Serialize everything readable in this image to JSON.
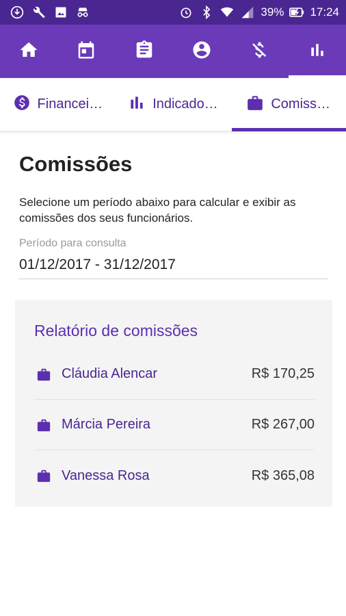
{
  "status_bar": {
    "battery": "39%",
    "time": "17:24"
  },
  "top_nav": {
    "items": [
      {
        "icon": "home-icon"
      },
      {
        "icon": "calendar-icon"
      },
      {
        "icon": "clipboard-icon"
      },
      {
        "icon": "account-icon"
      },
      {
        "icon": "money-off-icon"
      },
      {
        "icon": "bar-chart-icon",
        "active": true
      }
    ]
  },
  "sub_tabs": {
    "tabs": [
      {
        "label": "Financei…",
        "icon": "dollar-circle-icon"
      },
      {
        "label": "Indicado…",
        "icon": "bar-chart-icon"
      },
      {
        "label": "Comiss…",
        "icon": "briefcase-icon",
        "active": true
      }
    ]
  },
  "content": {
    "title": "Comissões",
    "description": "Selecione um período abaixo para calcular e exibir as comissões dos seus funcionários.",
    "period_label": "Período para consulta",
    "period_value": "01/12/2017 - 31/12/2017"
  },
  "report": {
    "title": "Relatório de comissões",
    "rows": [
      {
        "name": "Cláudia Alencar",
        "value": "R$ 170,25"
      },
      {
        "name": "Márcia Pereira",
        "value": "R$ 267,00"
      },
      {
        "name": "Vanessa Rosa",
        "value": "R$ 365,08"
      }
    ]
  },
  "colors": {
    "status_bar": "#4a2691",
    "app_bar": "#6a3ab9",
    "accent": "#5b2fb0"
  }
}
